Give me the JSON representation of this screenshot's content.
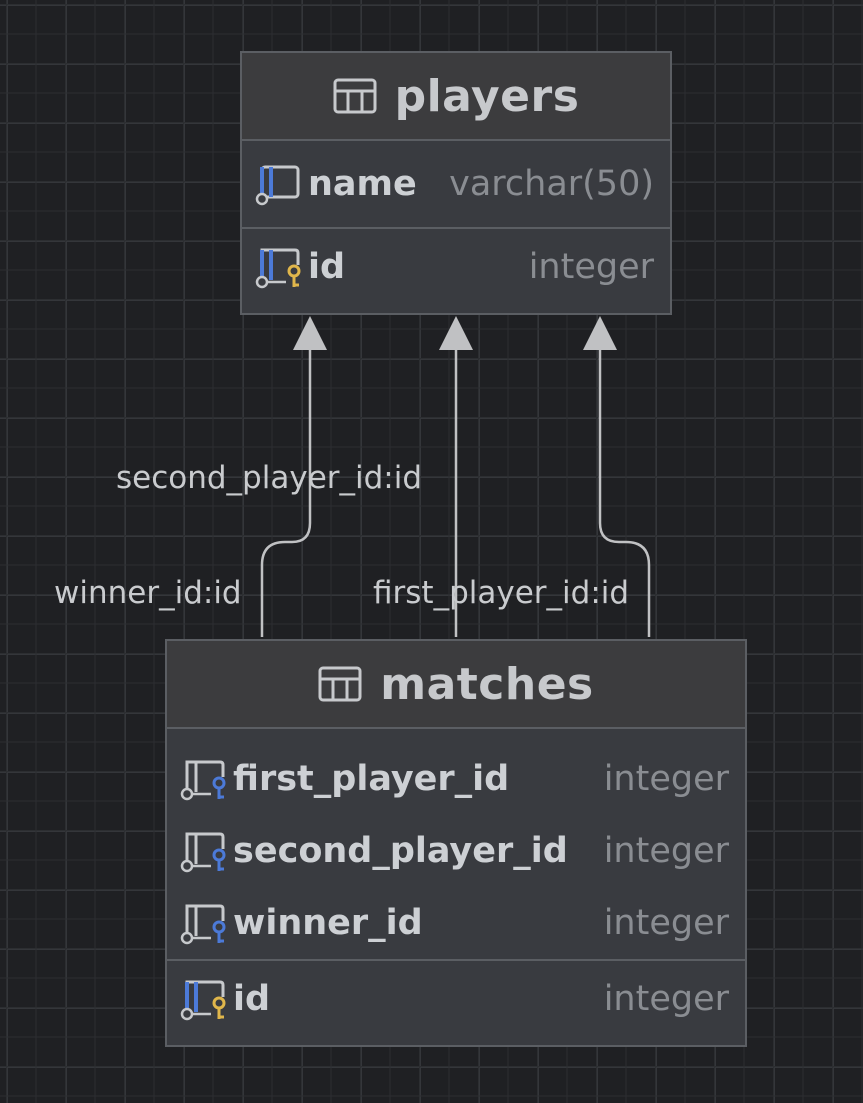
{
  "diagram": {
    "tables": {
      "players": {
        "name": "players",
        "icon": "table-icon",
        "columns": [
          {
            "name": "name",
            "type": "varchar(50)",
            "icon": "column-icon"
          }
        ],
        "keys": [
          {
            "name": "id",
            "type": "integer",
            "icon": "primary-key-column-icon"
          }
        ]
      },
      "matches": {
        "name": "matches",
        "icon": "table-icon",
        "columns": [
          {
            "name": "first_player_id",
            "type": "integer",
            "icon": "foreign-key-column-icon"
          },
          {
            "name": "second_player_id",
            "type": "integer",
            "icon": "foreign-key-column-icon"
          },
          {
            "name": "winner_id",
            "type": "integer",
            "icon": "foreign-key-column-icon"
          }
        ],
        "keys": [
          {
            "name": "id",
            "type": "integer",
            "icon": "primary-key-column-icon"
          }
        ]
      }
    },
    "relationships": [
      {
        "from": "matches.second_player_id",
        "to": "players.id",
        "label": "second_player_id:id"
      },
      {
        "from": "matches.winner_id",
        "to": "players.id",
        "label": "winner_id:id"
      },
      {
        "from": "matches.first_player_id",
        "to": "players.id",
        "label": "first_player_id:id"
      }
    ],
    "colors": {
      "background": "#1f2023",
      "table_body": "#393b40",
      "table_header": "#3c3c3e",
      "border": "#5b5e63",
      "column_icon_blue": "#4c7ad8",
      "primary_key_yellow": "#e0b64b",
      "foreign_key_blue": "#4c7ad8",
      "edge": "#c0c1c3"
    }
  }
}
